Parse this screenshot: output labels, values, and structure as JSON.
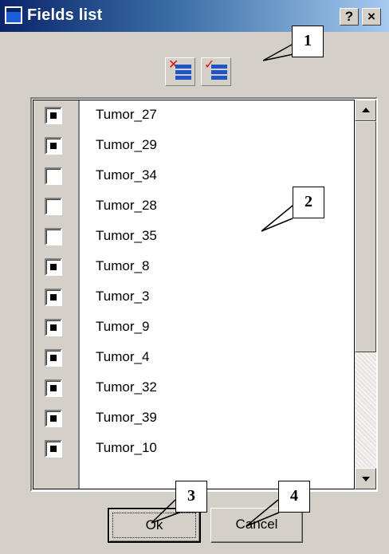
{
  "window": {
    "title": "Fields list",
    "help_label": "?",
    "close_label": "×"
  },
  "toolbar": {
    "uncheck_all_icon": "uncheck-all-icon",
    "check_all_icon": "check-all-icon"
  },
  "callouts": [
    "1",
    "2",
    "3",
    "4"
  ],
  "fields": [
    {
      "label": "Tumor_27",
      "checked": true
    },
    {
      "label": "Tumor_29",
      "checked": true
    },
    {
      "label": "Tumor_34",
      "checked": false
    },
    {
      "label": "Tumor_28",
      "checked": false
    },
    {
      "label": "Tumor_35",
      "checked": false
    },
    {
      "label": "Tumor_8",
      "checked": true
    },
    {
      "label": "Tumor_3",
      "checked": true
    },
    {
      "label": "Tumor_9",
      "checked": true
    },
    {
      "label": "Tumor_4",
      "checked": true
    },
    {
      "label": "Tumor_32",
      "checked": true
    },
    {
      "label": "Tumor_39",
      "checked": true
    },
    {
      "label": "Tumor_10",
      "checked": true
    }
  ],
  "buttons": {
    "ok": "Ok",
    "cancel": "Cancel"
  },
  "colors": {
    "titlebar_start": "#0a246a",
    "titlebar_end": "#a6caf0",
    "face": "#d4d0c8",
    "toolbar_bars": "#1f55c8",
    "toolbar_mark": "#e01010"
  }
}
